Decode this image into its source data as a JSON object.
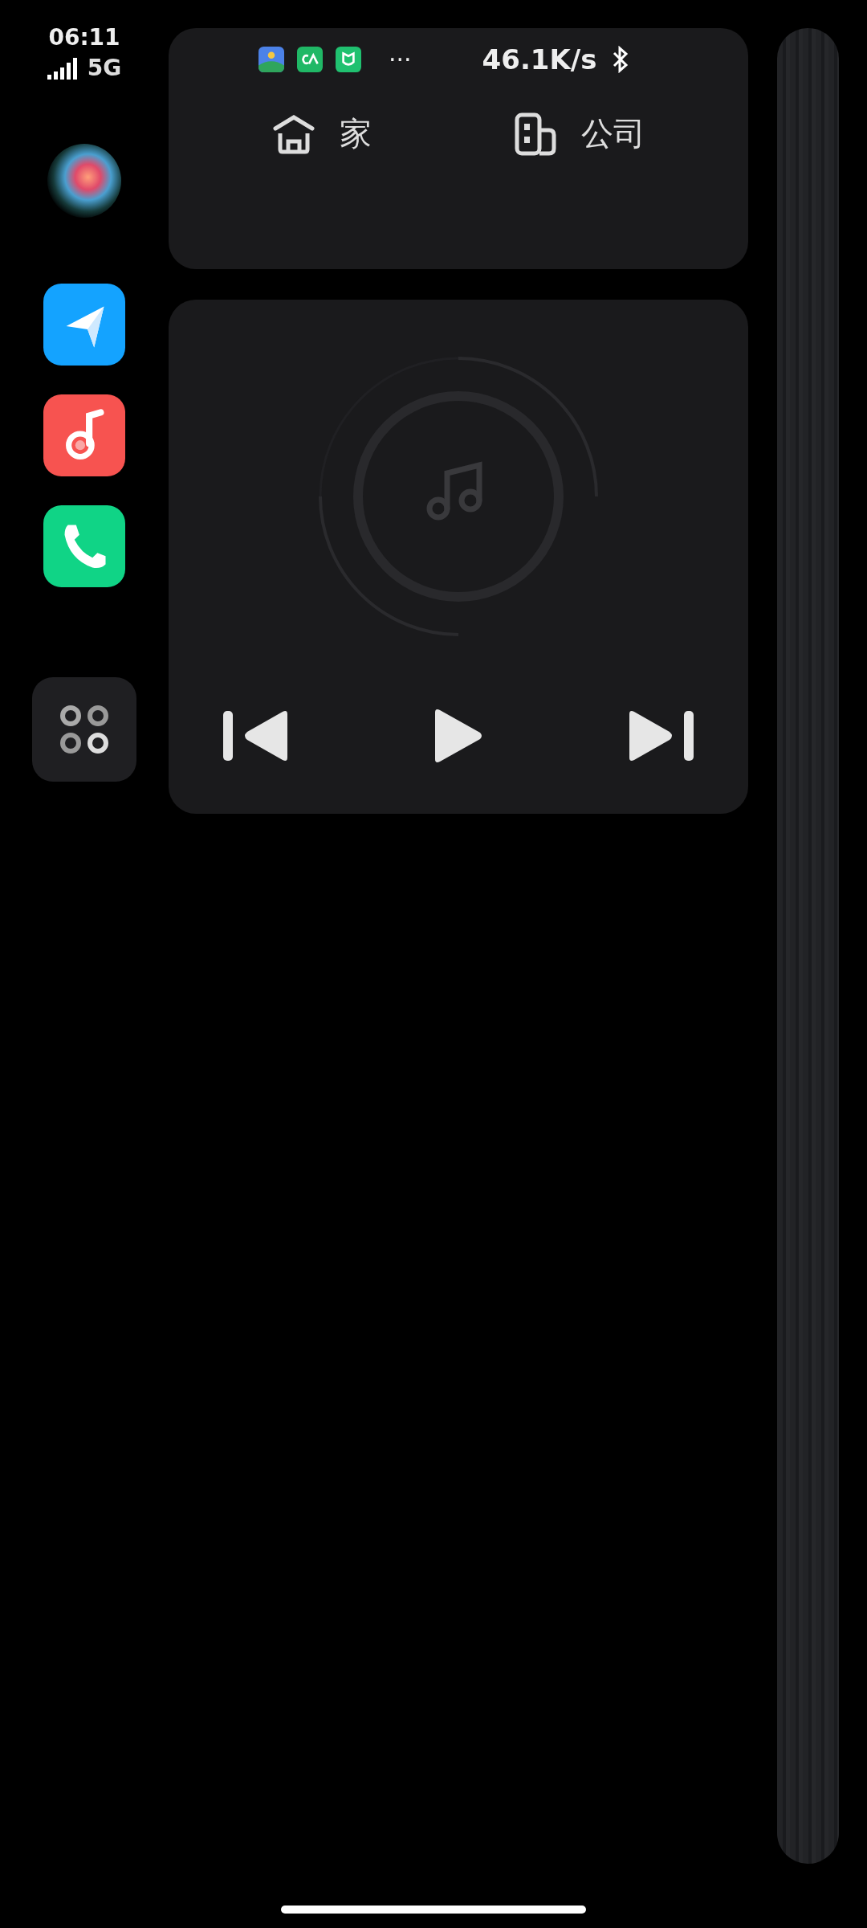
{
  "status_bar": {
    "time": "06:11",
    "network": "5G",
    "more": "···",
    "speed": "46.1K/s"
  },
  "shortcuts": [
    {
      "kind": "home",
      "label": "家"
    },
    {
      "kind": "office",
      "label": "公司"
    }
  ]
}
